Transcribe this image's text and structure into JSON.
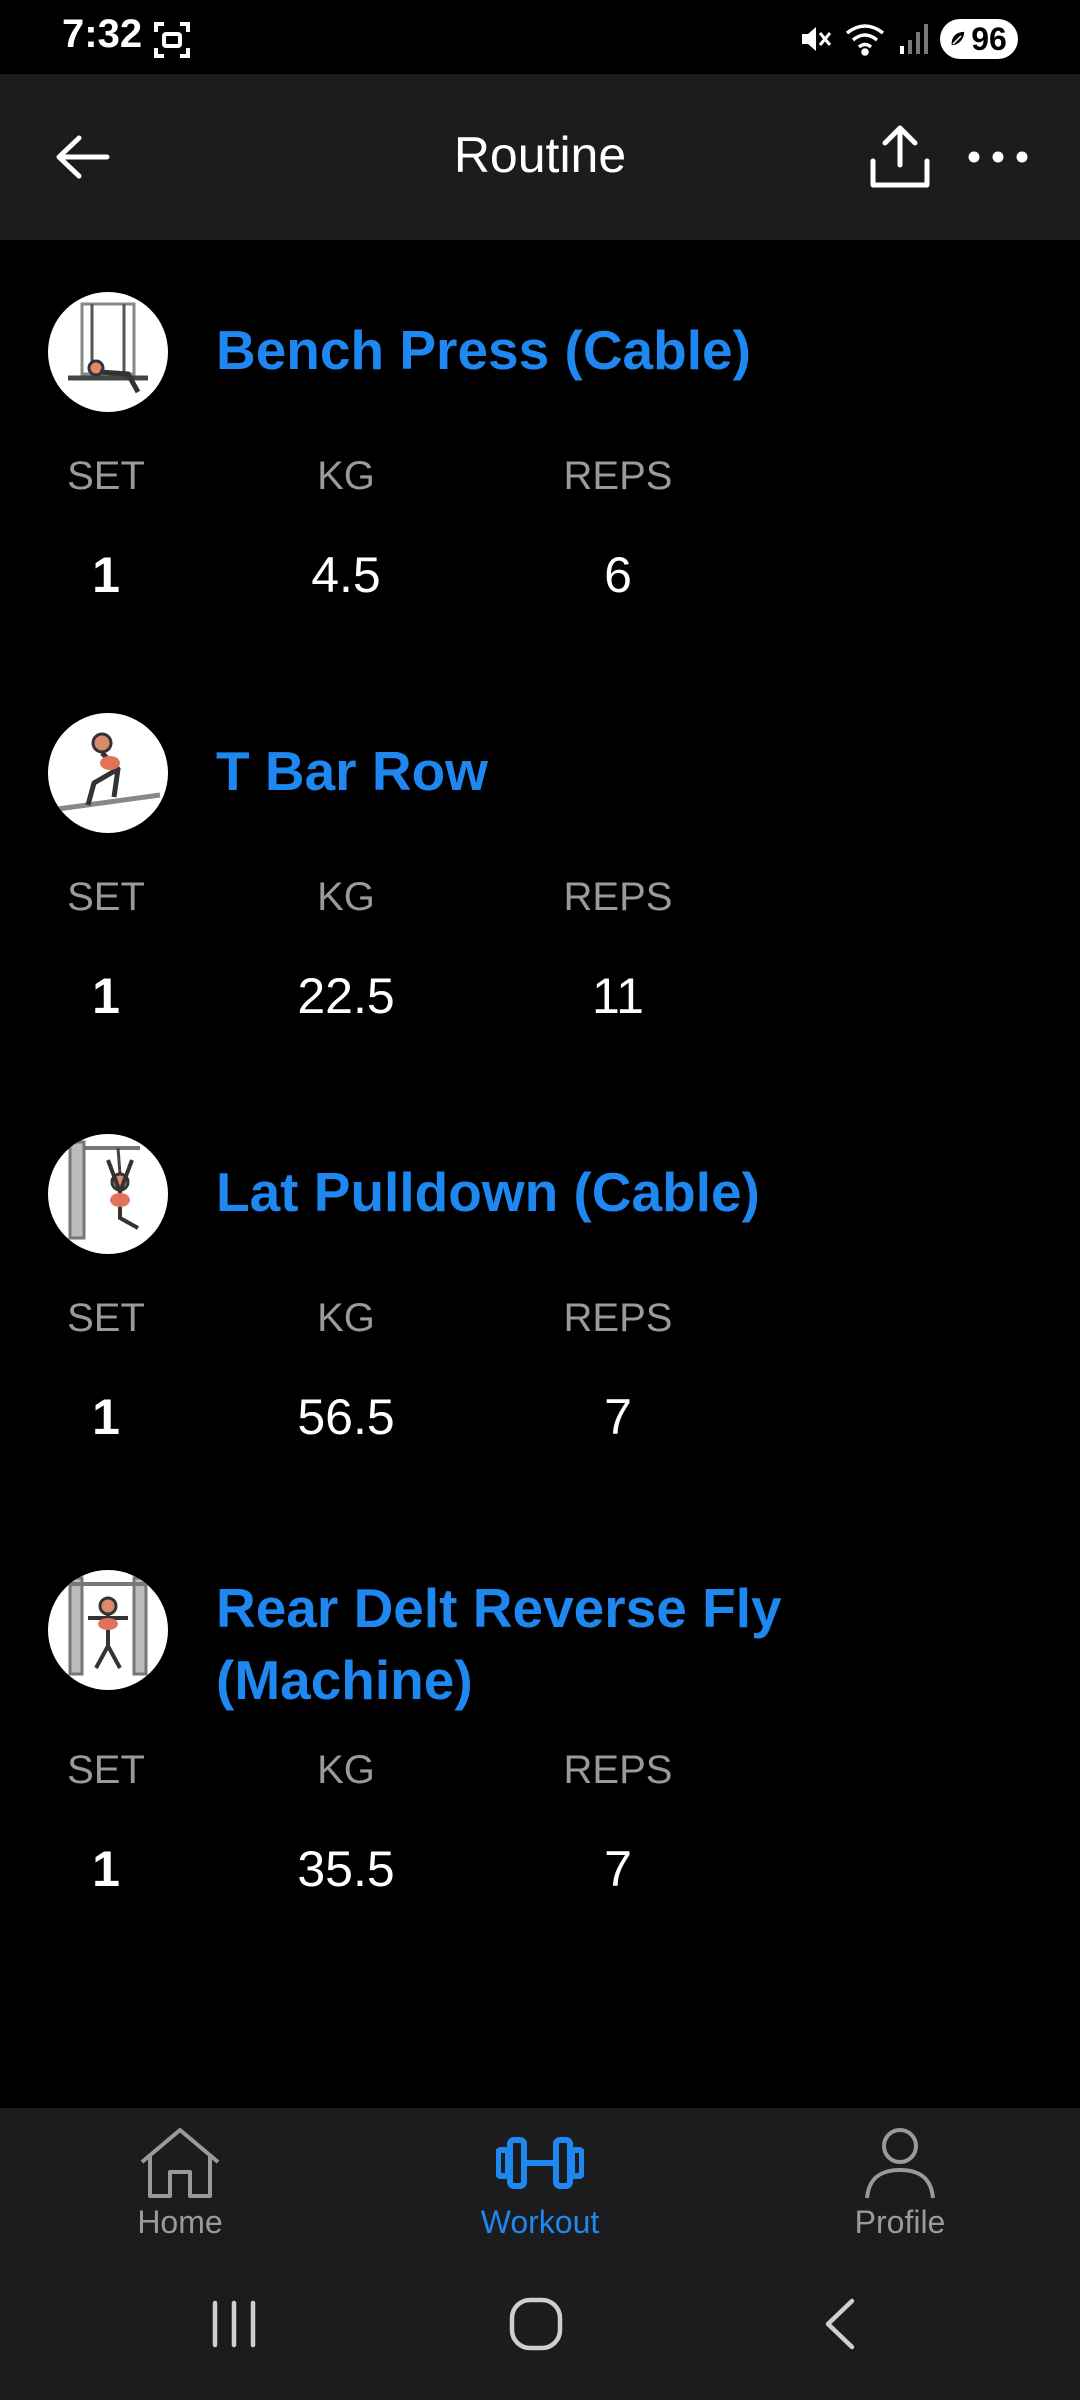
{
  "status_bar": {
    "time": "7:32",
    "battery": "96",
    "icons": [
      "screenshot-icon",
      "mute-icon",
      "wifi-icon",
      "signal-icon",
      "battery-saver-icon"
    ]
  },
  "header": {
    "title": "Routine",
    "back_icon": "arrow-left-icon",
    "share_icon": "share-upload-icon",
    "more_icon": "more-horizontal-icon"
  },
  "columns": {
    "set": "SET",
    "kg": "KG",
    "reps": "REPS"
  },
  "exercises": [
    {
      "name": "Bench Press (Cable)",
      "set": "1",
      "kg": "4.5",
      "reps": "6"
    },
    {
      "name": "T Bar Row",
      "set": "1",
      "kg": "22.5",
      "reps": "11"
    },
    {
      "name": "Lat Pulldown (Cable)",
      "set": "1",
      "kg": "56.5",
      "reps": "7"
    },
    {
      "name": "Rear Delt Reverse Fly (Machine)",
      "set": "1",
      "kg": "35.5",
      "reps": "7"
    }
  ],
  "bottom_nav": {
    "items": [
      {
        "label": "Home",
        "icon": "home-icon",
        "active": false
      },
      {
        "label": "Workout",
        "icon": "dumbbell-icon",
        "active": true
      },
      {
        "label": "Profile",
        "icon": "person-icon",
        "active": false
      }
    ]
  },
  "colors": {
    "accent": "#1e88f0",
    "background": "#000000",
    "surface": "#1c1c1e",
    "muted_text": "#9a9a9a"
  }
}
